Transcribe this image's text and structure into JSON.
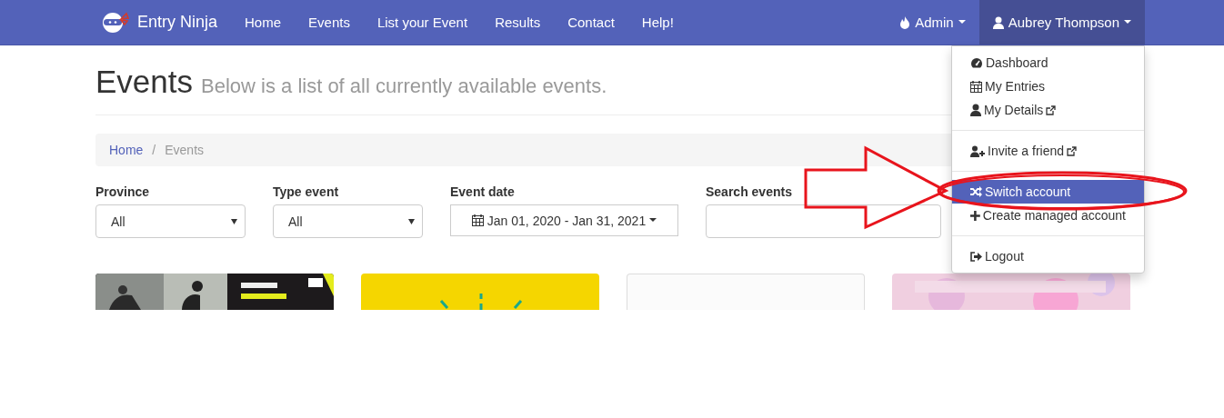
{
  "brand": {
    "name": "Entry Ninja"
  },
  "nav": [
    {
      "label": "Home"
    },
    {
      "label": "Events"
    },
    {
      "label": "List your Event"
    },
    {
      "label": "Results"
    },
    {
      "label": "Contact"
    },
    {
      "label": "Help!"
    }
  ],
  "nav_right": [
    {
      "label": "Admin",
      "open": false
    },
    {
      "label": "Aubrey Thompson",
      "open": true
    }
  ],
  "user_menu": {
    "groups": [
      [
        {
          "label": "Dashboard",
          "external": false,
          "selected": false
        },
        {
          "label": "My Entries",
          "external": false,
          "selected": false
        },
        {
          "label": "My Details",
          "external": true,
          "selected": false
        }
      ],
      [
        {
          "label": "Invite a friend",
          "external": true,
          "selected": false
        }
      ],
      [
        {
          "label": "Switch account",
          "external": false,
          "selected": true
        },
        {
          "label": "Create managed account",
          "external": false,
          "selected": false
        }
      ],
      [
        {
          "label": "Logout",
          "external": false,
          "selected": false
        }
      ]
    ]
  },
  "page_header": {
    "title": "Events",
    "subtitle": "Below is a list of all currently available events."
  },
  "breadcrumb": [
    {
      "label": "Home",
      "active": false
    },
    {
      "separator": "/"
    },
    {
      "label": "Events",
      "active": true
    }
  ],
  "filters": [
    {
      "kind": "select",
      "label": "Province",
      "value": "All"
    },
    {
      "kind": "select",
      "label": "Type event",
      "value": "All"
    },
    {
      "kind": "daterange",
      "label": "Event date",
      "value": "Jan 01, 2020 - Jan 31, 2021"
    },
    {
      "kind": "search",
      "label": "Search events"
    }
  ],
  "event_cards": [
    {
      "kind": "picture"
    },
    {
      "kind": "picture"
    },
    {
      "kind": "blank"
    },
    {
      "kind": "picture"
    }
  ]
}
